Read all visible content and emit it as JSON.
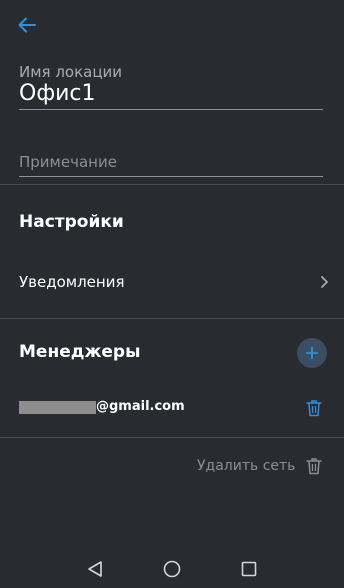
{
  "header": {
    "back_icon": "arrow-left-icon"
  },
  "location": {
    "name_label": "Имя локации",
    "name_value": "Офис1",
    "note_placeholder": "Примечание",
    "note_value": ""
  },
  "settings": {
    "title": "Настройки",
    "notifications_label": "Уведомления",
    "chevron_icon": "chevron-right-icon"
  },
  "managers": {
    "title": "Менеджеры",
    "add_icon": "plus-icon",
    "items": [
      {
        "email_visible": "@gmail.com",
        "delete_icon": "trash-icon"
      }
    ]
  },
  "delete_network": {
    "label": "Удалить сеть",
    "icon": "trash-icon"
  },
  "nav_bar": {
    "back_icon": "triangle-back-icon",
    "home_icon": "circle-home-icon",
    "recents_icon": "square-recents-icon"
  },
  "colors": {
    "background": "#2a2b30",
    "accent": "#2f8fdd",
    "divider": "#4a4c52",
    "add_button_bg": "#3b4d62"
  }
}
